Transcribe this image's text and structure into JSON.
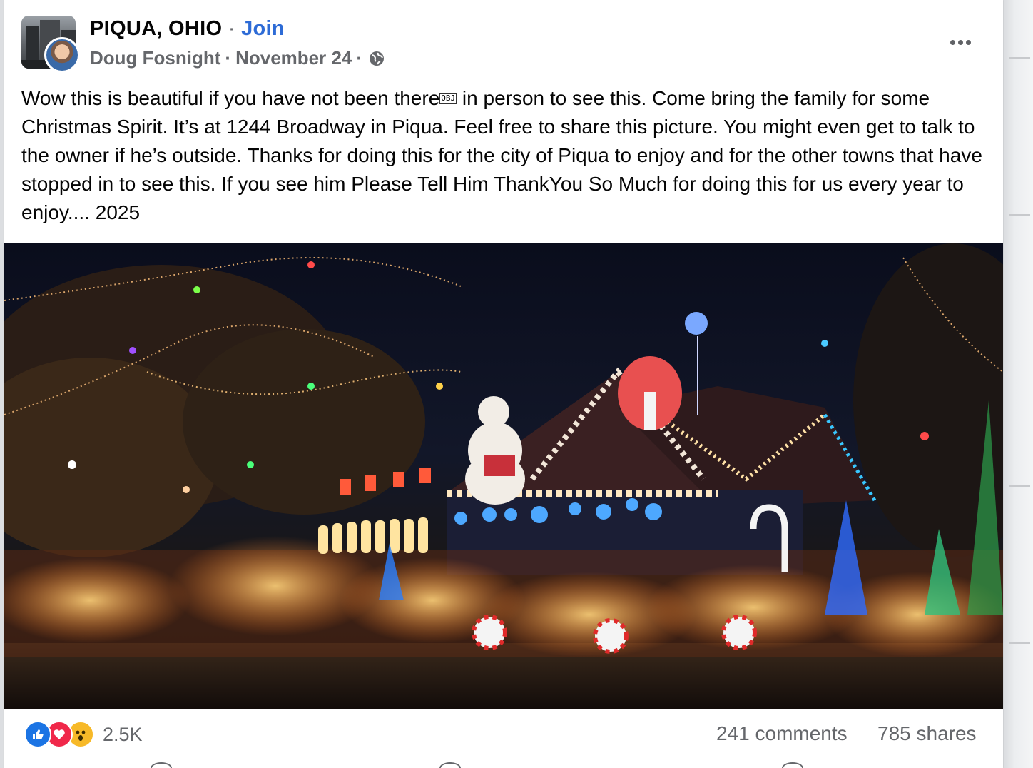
{
  "post": {
    "group_name": "PIQUA, OHIO",
    "separator": "·",
    "join_label": "Join",
    "author": "Doug Fosnight",
    "date": "November 24",
    "privacy_icon": "globe-icon",
    "more_icon": "more-horizontal-icon",
    "text_part1": "Wow this is beautiful if you have not been there",
    "text_obj": "OBJ",
    "text_part2": " in person to see this. Come bring the family for some Christmas Spirit. It’s at 1244 Broadway in Piqua. Feel free to share this picture. You might even get to talk to the owner if he’s outside. Thanks for doing this for the city of Piqua to enjoy and for the other towns that have stopped in to see this. If you see him Please Tell Him ThankYou So Much for doing this for us every year to enjoy.... 2025"
  },
  "footer": {
    "reactions": [
      "like-icon",
      "love-icon",
      "wow-icon"
    ],
    "reaction_count": "2.5K",
    "comments": "241 comments",
    "shares": "785 shares"
  },
  "colors": {
    "accent": "#2d6bd6",
    "secondary_text": "#65676b",
    "like": "#1b74e4",
    "love": "#f0284a",
    "wow": "#f7b928"
  }
}
